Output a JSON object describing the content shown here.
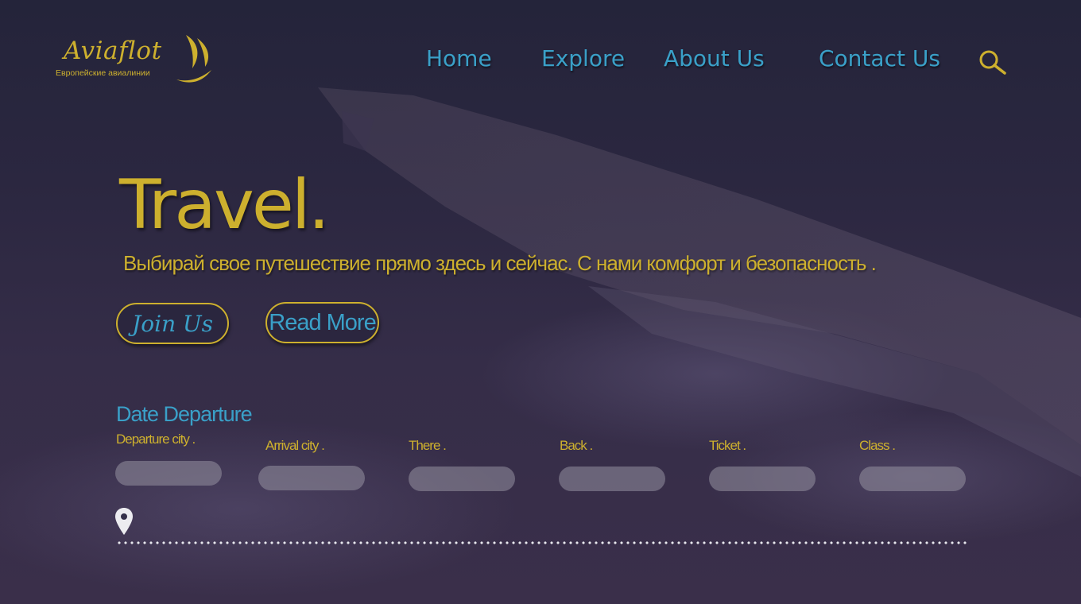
{
  "brand": {
    "name": "Aviaflot",
    "tagline": "Европейские авиалинии",
    "accent_color": "#cdb02e",
    "link_color": "#3aa0c8"
  },
  "nav": {
    "items": [
      "Home",
      "Explore",
      "About Us",
      "Contact Us"
    ],
    "search_icon": "search-icon"
  },
  "hero": {
    "title": "Travel.",
    "subtitle": "Выбирай свое путешествие прямо здесь и сейчас. С нами комфорт и безопасность .",
    "join_label": "Join Us",
    "read_more_label": "Read More"
  },
  "booking": {
    "title": "Date Departure",
    "fields": [
      {
        "label": "Departure city .",
        "value": ""
      },
      {
        "label": "Arrival city .",
        "value": ""
      },
      {
        "label": "There .",
        "value": ""
      },
      {
        "label": "Back .",
        "value": ""
      },
      {
        "label": "Ticket .",
        "value": ""
      },
      {
        "label": "Class .",
        "value": ""
      }
    ],
    "location_icon": "map-pin-icon"
  }
}
